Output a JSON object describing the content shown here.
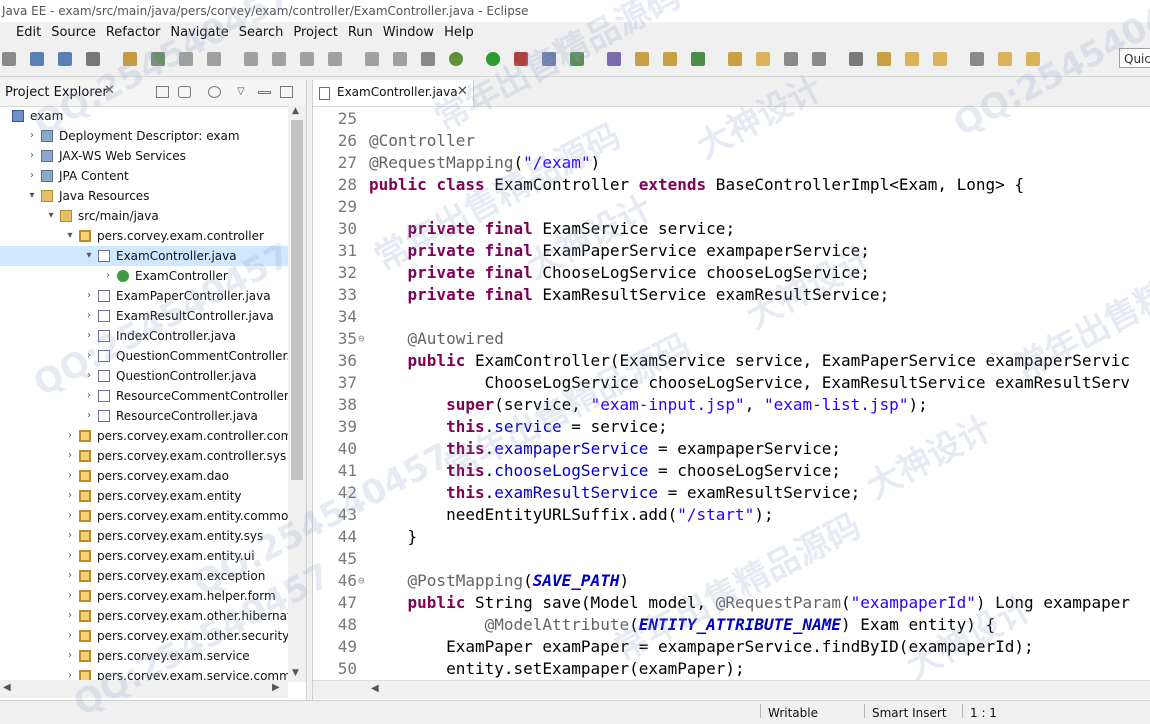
{
  "window": {
    "title": "Java EE - exam/src/main/java/pers/corvey/exam/controller/ExamController.java - Eclipse"
  },
  "menu": [
    "Edit",
    "Source",
    "Refactor",
    "Navigate",
    "Search",
    "Project",
    "Run",
    "Window",
    "Help"
  ],
  "quick_access": {
    "value": "Quic"
  },
  "explorer": {
    "title": "Project Explorer",
    "close": "✕",
    "items": [
      {
        "label": "exam",
        "icon": "project-icon"
      },
      {
        "label": "Deployment Descriptor: exam",
        "icon": "descriptor-icon"
      },
      {
        "label": "JAX-WS Web Services",
        "icon": "webservice-icon"
      },
      {
        "label": "JPA Content",
        "icon": "jpa-icon"
      },
      {
        "label": "Java Resources",
        "icon": "java-resources-icon"
      },
      {
        "label": "src/main/java",
        "icon": "source-folder-icon"
      },
      {
        "label": "pers.corvey.exam.controller",
        "icon": "package-icon"
      },
      {
        "label": "ExamController.java",
        "icon": "java-file-icon",
        "selected": true
      },
      {
        "label": "ExamController",
        "icon": "class-icon"
      },
      {
        "label": "ExamPaperController.java",
        "icon": "java-file-icon"
      },
      {
        "label": "ExamResultController.java",
        "icon": "java-file-icon"
      },
      {
        "label": "IndexController.java",
        "icon": "java-file-icon"
      },
      {
        "label": "QuestionCommentController.jav",
        "icon": "java-file-icon"
      },
      {
        "label": "QuestionController.java",
        "icon": "java-file-icon"
      },
      {
        "label": "ResourceCommentController.jav",
        "icon": "java-file-icon"
      },
      {
        "label": "ResourceController.java",
        "icon": "java-file-icon"
      },
      {
        "label": "pers.corvey.exam.controller.commc",
        "icon": "package-icon"
      },
      {
        "label": "pers.corvey.exam.controller.sys",
        "icon": "package-icon"
      },
      {
        "label": "pers.corvey.exam.dao",
        "icon": "package-icon"
      },
      {
        "label": "pers.corvey.exam.entity",
        "icon": "package-icon"
      },
      {
        "label": "pers.corvey.exam.entity.common",
        "icon": "package-icon"
      },
      {
        "label": "pers.corvey.exam.entity.sys",
        "icon": "package-icon"
      },
      {
        "label": "pers.corvey.exam.entity.ui",
        "icon": "package-icon"
      },
      {
        "label": "pers.corvey.exam.exception",
        "icon": "package-icon"
      },
      {
        "label": "pers.corvey.exam.helper.form",
        "icon": "package-icon"
      },
      {
        "label": "pers.corvey.exam.other.hibernate",
        "icon": "package-icon"
      },
      {
        "label": "pers.corvey.exam.other.security",
        "icon": "package-icon"
      },
      {
        "label": "pers.corvey.exam.service",
        "icon": "package-icon"
      },
      {
        "label": "pers.corvey.exam.service.common",
        "icon": "package-icon"
      }
    ]
  },
  "editor": {
    "tab_label": "ExamController.java",
    "tab_close": "✕",
    "lines": [
      {
        "n": "25",
        "text": ""
      },
      {
        "n": "26",
        "text": "@Controller"
      },
      {
        "n": "27",
        "text": "@RequestMapping(\"/exam\")"
      },
      {
        "n": "28",
        "text": "public class ExamController extends BaseControllerImpl<Exam, Long> {"
      },
      {
        "n": "29",
        "text": ""
      },
      {
        "n": "30",
        "text": "    private final ExamService service;"
      },
      {
        "n": "31",
        "text": "    private final ExamPaperService exampaperService;"
      },
      {
        "n": "32",
        "text": "    private final ChooseLogService chooseLogService;"
      },
      {
        "n": "33",
        "text": "    private final ExamResultService examResultService;"
      },
      {
        "n": "34",
        "text": ""
      },
      {
        "n": "35",
        "text": "    @Autowired"
      },
      {
        "n": "36",
        "text": "    public ExamController(ExamService service, ExamPaperService exampaperServic"
      },
      {
        "n": "37",
        "text": "            ChooseLogService chooseLogService, ExamResultService examResultServ"
      },
      {
        "n": "38",
        "text": "        super(service, \"exam-input.jsp\", \"exam-list.jsp\");"
      },
      {
        "n": "39",
        "text": "        this.service = service;"
      },
      {
        "n": "40",
        "text": "        this.exampaperService = exampaperService;"
      },
      {
        "n": "41",
        "text": "        this.chooseLogService = chooseLogService;"
      },
      {
        "n": "42",
        "text": "        this.examResultService = examResultService;"
      },
      {
        "n": "43",
        "text": "        needEntityURLSuffix.add(\"/start\");"
      },
      {
        "n": "44",
        "text": "    }"
      },
      {
        "n": "45",
        "text": ""
      },
      {
        "n": "46",
        "text": "    @PostMapping(SAVE_PATH)"
      },
      {
        "n": "47",
        "text": "    public String save(Model model, @RequestParam(\"exampaperId\") Long exampaper"
      },
      {
        "n": "48",
        "text": "            @ModelAttribute(ENTITY_ATTRIBUTE_NAME) Exam entity) {"
      },
      {
        "n": "49",
        "text": "        ExamPaper examPaper = exampaperService.findByID(exampaperId);"
      },
      {
        "n": "50",
        "text": "        entity.setExampaper(examPaper);"
      }
    ]
  },
  "status": {
    "writable": "Writable",
    "insert_mode": "Smart Insert",
    "position": "1 : 1"
  },
  "watermarks": [
    "QQ:254540457",
    "常年出售精品源码",
    "大神设计"
  ]
}
